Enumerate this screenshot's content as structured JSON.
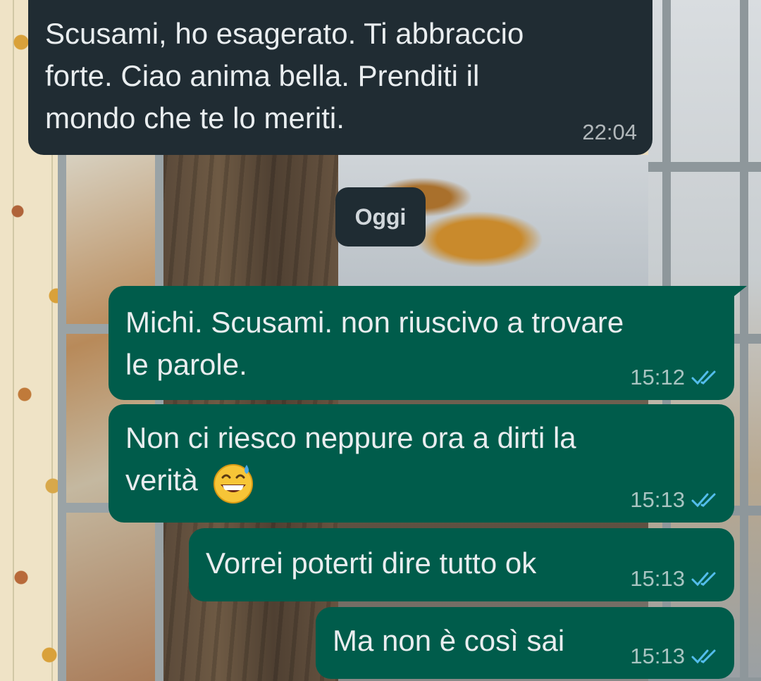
{
  "day_separator": "Oggi",
  "messages": [
    {
      "direction": "incoming",
      "text_lines": [
        "Scusami, ho esagerato. Ti abbraccio",
        "forte.  Ciao anima bella. Prenditi il",
        "mondo che te lo meriti."
      ],
      "time": "22:04"
    },
    {
      "direction": "outgoing",
      "text_lines": [
        "Michi. Scusami. non riuscivo a trovare",
        "le parole."
      ],
      "time": "15:12",
      "status": "read"
    },
    {
      "direction": "outgoing",
      "text_lines": [
        "Non ci riesco neppure ora a dirti la",
        "verità"
      ],
      "emoji": "grinning-sweat-emoji",
      "time": "15:13",
      "status": "read"
    },
    {
      "direction": "outgoing",
      "text_lines": [
        "Vorrei poterti dire tutto ok"
      ],
      "time": "15:13",
      "status": "read"
    },
    {
      "direction": "outgoing",
      "text_lines": [
        "Ma non è così sai"
      ],
      "time": "15:13",
      "status": "read"
    }
  ],
  "colors": {
    "incoming_bubble": "#202c33",
    "outgoing_bubble": "#005c4b",
    "read_ticks": "#53bdeb"
  },
  "icons": {
    "read_receipt": "double-check-icon"
  }
}
